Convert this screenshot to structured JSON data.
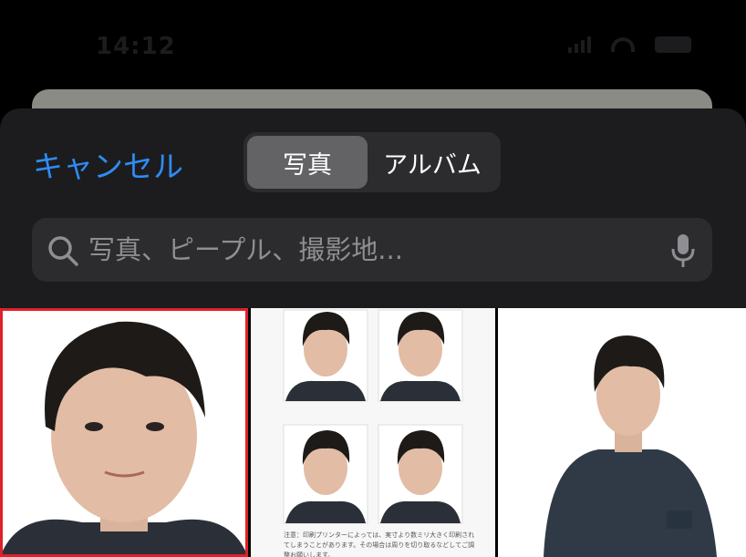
{
  "status_bar": {
    "time": "14:12"
  },
  "picker": {
    "cancel_label": "キャンセル",
    "tabs": [
      {
        "label": "写真",
        "selected": true
      },
      {
        "label": "アルバム",
        "selected": false
      }
    ],
    "search": {
      "placeholder": "写真、ピープル、撮影地..."
    }
  },
  "photos": [
    {
      "name": "headshot-closeup",
      "selected": true
    },
    {
      "name": "id-photo-sheet",
      "selected": false,
      "note": "注意：印刷プリンターによっては、実寸より数ミリ大きく印刷されてしまうことがあります。その場合は周りを切り取るなどしてご調整お願いします。"
    },
    {
      "name": "half-body-portrait",
      "selected": false
    }
  ],
  "colors": {
    "accent": "#2f8cf4",
    "sheet_background": "#1c1c1e",
    "control_background": "#2c2c2e",
    "selected_segment": "#636366",
    "selection_border": "#e0202a"
  }
}
